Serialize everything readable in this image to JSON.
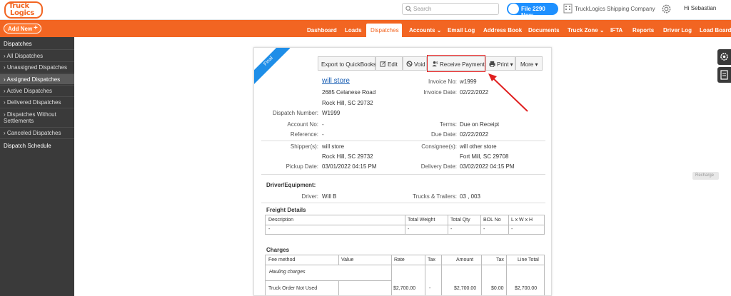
{
  "header": {
    "logo_line1": "Truck",
    "logo_line2": "Logics",
    "search_placeholder": "Search",
    "phone_button": "File 2290 Now",
    "company": "TruckLogics Shipping Company",
    "greeting": "Hi Sebastian"
  },
  "nav": {
    "add_new": "Add New",
    "items": [
      "Dashboard",
      "Loads",
      "Dispatches",
      "Accounts",
      "Email Log",
      "Address Book",
      "Documents",
      "Truck Zone",
      "IFTA",
      "Reports",
      "Driver Log",
      "Load Board"
    ],
    "active": "Dispatches"
  },
  "sidebar": {
    "heading": "Dispatches",
    "items": [
      "All Dispatches",
      "Unassigned Dispatches",
      "Assigned Dispatches",
      "Active Dispatches",
      "Delivered Dispatches",
      "Dispatches Without Settlements",
      "Canceled Dispatches"
    ],
    "active_index": 2,
    "schedule": "Dispatch Schedule"
  },
  "doc": {
    "ribbon": "Final",
    "toolbar": {
      "export": "Export to QuickBooks",
      "edit": "Edit",
      "void": "Void",
      "receive_payment": "Receive Payment",
      "print": "Print",
      "more": "More"
    },
    "customer": {
      "name": "will store",
      "address1": "2685 Celanese Road",
      "address2": "Rock Hill, SC 29732"
    },
    "invoice_no_label": "Invoice No:",
    "invoice_no": "w1999",
    "invoice_date_label": "Invoice Date:",
    "invoice_date": "02/22/2022",
    "dispatch_number_label": "Dispatch Number:",
    "dispatch_number": "W1999",
    "account_no_label": "Account No:",
    "account_no": "-",
    "terms_label": "Terms:",
    "terms": "Due on Receipt",
    "reference_label": "Reference:",
    "reference": "-",
    "due_date_label": "Due Date:",
    "due_date": "02/22/2022",
    "shipper_label": "Shipper(s):",
    "shipper_name": "will store",
    "shipper_city": "Rock Hill, SC 29732",
    "consignee_label": "Consignee(s):",
    "consignee_name": "will other store",
    "consignee_city": "Fort Mill, SC 29708",
    "pickup_label": "Pickup Date:",
    "pickup_date": "03/01/2022 04:15 PM",
    "delivery_label": "Delivery Date:",
    "delivery_date": "03/02/2022 04:15 PM",
    "driver_section": "Driver/Equipment:",
    "driver_label": "Driver:",
    "driver": "Will B",
    "trucks_label": "Trucks & Trailers:",
    "trucks": "03 , 003",
    "freight_section": "Freight Details",
    "freight_headers": [
      "Description",
      "Total Weight",
      "Total Qty",
      "BOL No",
      "L x W x H"
    ],
    "freight_row": [
      "-",
      "-",
      "-",
      "-",
      "-"
    ],
    "charges_section": "Charges",
    "charges_headers": [
      "Fee method",
      "Value",
      "Rate",
      "Tax",
      "Amount",
      "Tax",
      "Line Total"
    ],
    "hauling": "Hauling charges",
    "charge_row": [
      "Truck Order Not Used",
      "",
      "$2,700.00",
      "-",
      "$2,700.00",
      "$0.00",
      "$2,700.00"
    ]
  },
  "right": {
    "recharge": "Recharge"
  }
}
